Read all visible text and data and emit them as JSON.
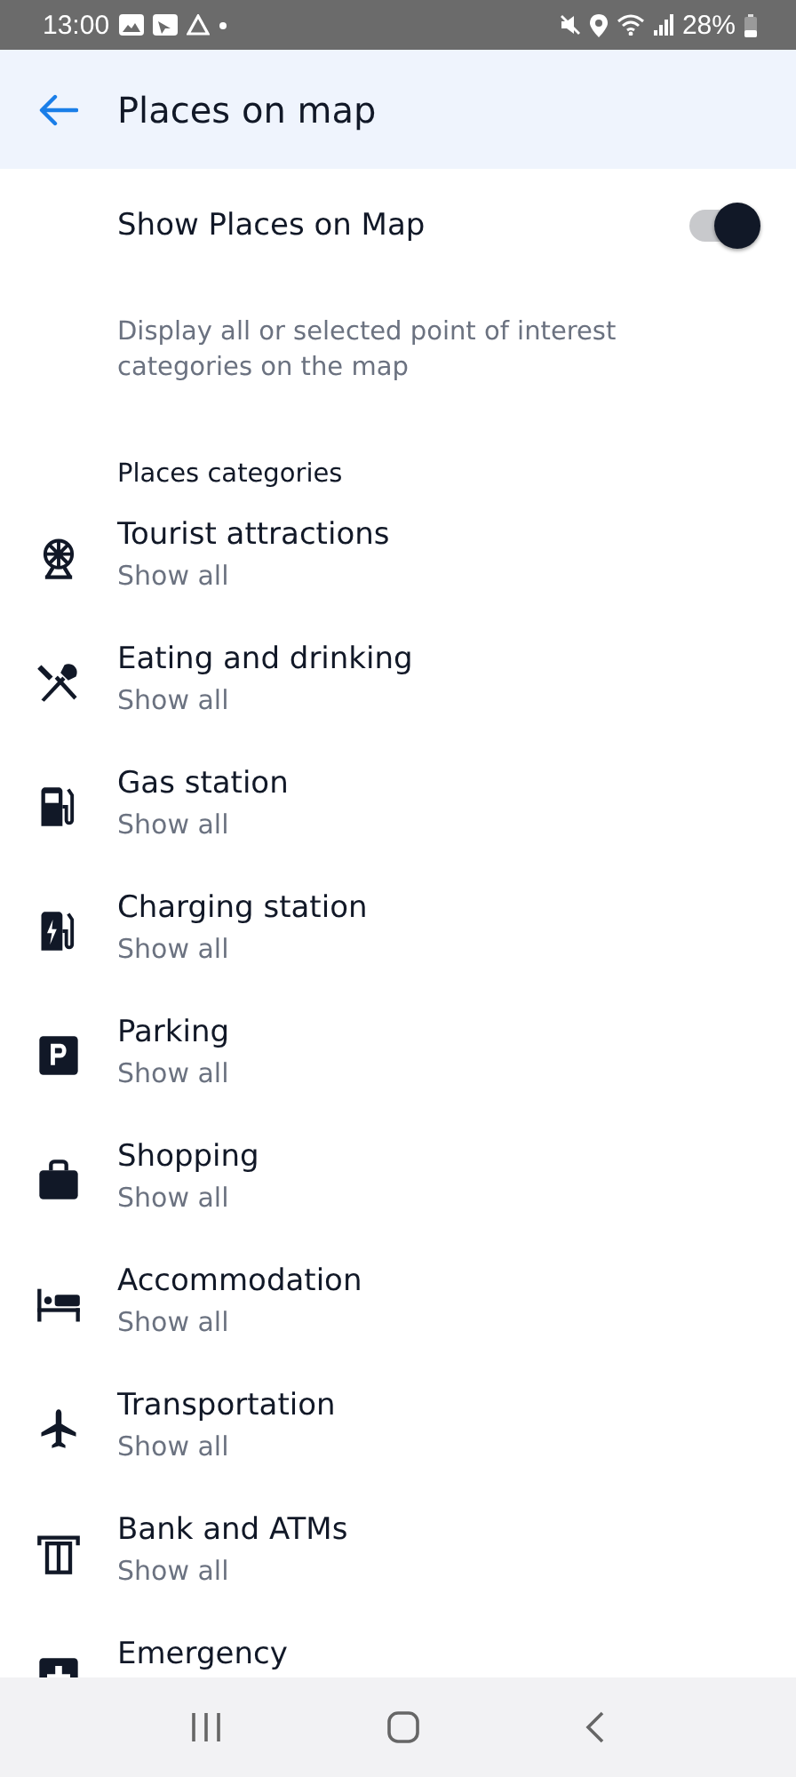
{
  "status_bar": {
    "time": "13:00",
    "battery": "28%"
  },
  "header": {
    "title": "Places on map"
  },
  "toggle": {
    "label": "Show Places on Map",
    "on": true
  },
  "description": "Display all or selected point of interest categories on the map",
  "section": "Places categories",
  "categories": [
    {
      "kind": "ferris-wheel",
      "title": "Tourist attractions",
      "subtitle": "Show all"
    },
    {
      "kind": "fork-knife",
      "title": "Eating and drinking",
      "subtitle": "Show all"
    },
    {
      "kind": "fuel",
      "title": "Gas station",
      "subtitle": "Show all"
    },
    {
      "kind": "charger",
      "title": "Charging station",
      "subtitle": "Show all"
    },
    {
      "kind": "parking",
      "title": "Parking",
      "subtitle": "Show all"
    },
    {
      "kind": "bag",
      "title": "Shopping",
      "subtitle": "Show all"
    },
    {
      "kind": "bed",
      "title": "Accommodation",
      "subtitle": "Show all"
    },
    {
      "kind": "plane",
      "title": "Transportation",
      "subtitle": "Show all"
    },
    {
      "kind": "atm",
      "title": "Bank and ATMs",
      "subtitle": "Show all"
    },
    {
      "kind": "medical",
      "title": "Emergency"
    }
  ]
}
